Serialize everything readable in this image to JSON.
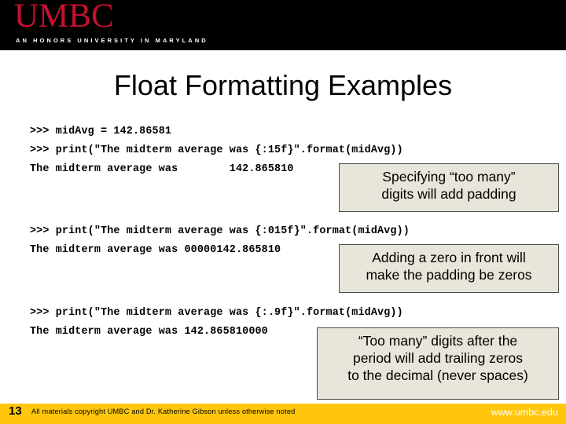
{
  "header": {
    "wordmark": "UMBC",
    "tagline": "AN HONORS UNIVERSITY IN MARYLAND",
    "background_color": "#000000",
    "wordmark_color": "#c8102e"
  },
  "slide": {
    "title": "Float Formatting Examples"
  },
  "code_blocks": [
    {
      "lines": [
        ">>> midAvg = 142.86581",
        ">>> print(\"The midterm average was {:15f}\".format(midAvg))",
        "The midterm average was        142.865810"
      ]
    },
    {
      "lines": [
        ">>> print(\"The midterm average was {:015f}\".format(midAvg))",
        "The midterm average was 00000142.865810"
      ]
    },
    {
      "lines": [
        ">>> print(\"The midterm average was {:.9f}\".format(midAvg))",
        "The midterm average was 142.865810000"
      ]
    }
  ],
  "callouts": [
    {
      "name": "padding",
      "lines": [
        "Specifying “too many”",
        "digits will add padding"
      ],
      "background_color": "#e8e6da",
      "border_color": "#4a4a4a"
    },
    {
      "name": "zeros",
      "lines": [
        "Adding a zero in front will",
        "make the padding be zeros"
      ],
      "background_color": "#e8e6da",
      "border_color": "#4a4a4a"
    },
    {
      "name": "trailing",
      "lines": [
        "“Too many” digits after the",
        "period will add trailing zeros",
        "to the decimal (never spaces)"
      ],
      "background_color": "#e8e6da",
      "border_color": "#4a4a4a"
    }
  ],
  "footer": {
    "slide_number": "13",
    "credit": "All materials copyright UMBC and Dr. Katherine Gibson unless otherwise noted",
    "url": "www.umbc.edu",
    "background_color": "#ffc60b"
  }
}
